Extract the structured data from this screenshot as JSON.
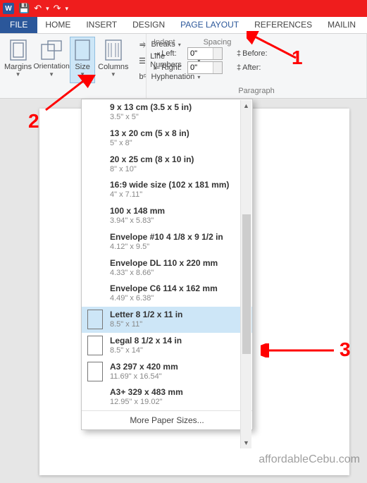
{
  "qat": {
    "save": "💾",
    "undo": "↶",
    "redo": "↷",
    "dd": "▾"
  },
  "tabs": {
    "file": "FILE",
    "home": "HOME",
    "insert": "INSERT",
    "design": "DESIGN",
    "pageLayout": "PAGE LAYOUT",
    "references": "REFERENCES",
    "mailings": "MAILIN"
  },
  "pageSetup": {
    "margins": "Margins",
    "orientation": "Orientation",
    "size": "Size",
    "columns": "Columns",
    "breaks": "Breaks",
    "lineNumbers": "Line Numbers",
    "hyphenation": "Hyphenation"
  },
  "paragraph": {
    "indentHeader": "Indent",
    "spacingHeader": "Spacing",
    "leftLabel": "Left:",
    "rightLabel": "Right:",
    "beforeLabel": "Before:",
    "afterLabel": "After:",
    "leftVal": "0\"",
    "rightVal": "0\"",
    "groupLabel": "Paragraph"
  },
  "sizeMenu": {
    "items": [
      {
        "name": "9 x 13 cm (3.5 x 5 in)",
        "dim": "3.5\" x 5\"",
        "icon": false,
        "sel": false
      },
      {
        "name": "13 x 20 cm (5 x 8 in)",
        "dim": "5\" x 8\"",
        "icon": false,
        "sel": false
      },
      {
        "name": "20 x 25 cm (8 x 10 in)",
        "dim": "8\" x 10\"",
        "icon": false,
        "sel": false
      },
      {
        "name": "16:9 wide size (102 x 181 mm)",
        "dim": "4\" x 7.11\"",
        "icon": false,
        "sel": false
      },
      {
        "name": "100 x 148 mm",
        "dim": "3.94\" x 5.83\"",
        "icon": false,
        "sel": false
      },
      {
        "name": "Envelope #10 4 1/8 x 9 1/2 in",
        "dim": "4.12\" x 9.5\"",
        "icon": false,
        "sel": false
      },
      {
        "name": "Envelope DL  110 x 220 mm",
        "dim": "4.33\" x 8.66\"",
        "icon": false,
        "sel": false
      },
      {
        "name": "Envelope C6  114 x 162 mm",
        "dim": "4.49\" x 6.38\"",
        "icon": false,
        "sel": false
      },
      {
        "name": "Letter 8 1/2 x 11 in",
        "dim": "8.5\" x 11\"",
        "icon": true,
        "sel": true
      },
      {
        "name": "Legal 8 1/2 x 14 in",
        "dim": "8.5\" x 14\"",
        "icon": true,
        "sel": false
      },
      {
        "name": "A3 297 x 420 mm",
        "dim": "11.69\" x 16.54\"",
        "icon": true,
        "sel": false
      },
      {
        "name": "A3+ 329 x 483 mm",
        "dim": "12.95\" x 19.02\"",
        "icon": false,
        "sel": false
      }
    ],
    "footer": "More Paper Sizes..."
  },
  "annotations": {
    "a1": "1",
    "a2": "2",
    "a3": "3"
  },
  "watermark": "affordableCebu.com"
}
